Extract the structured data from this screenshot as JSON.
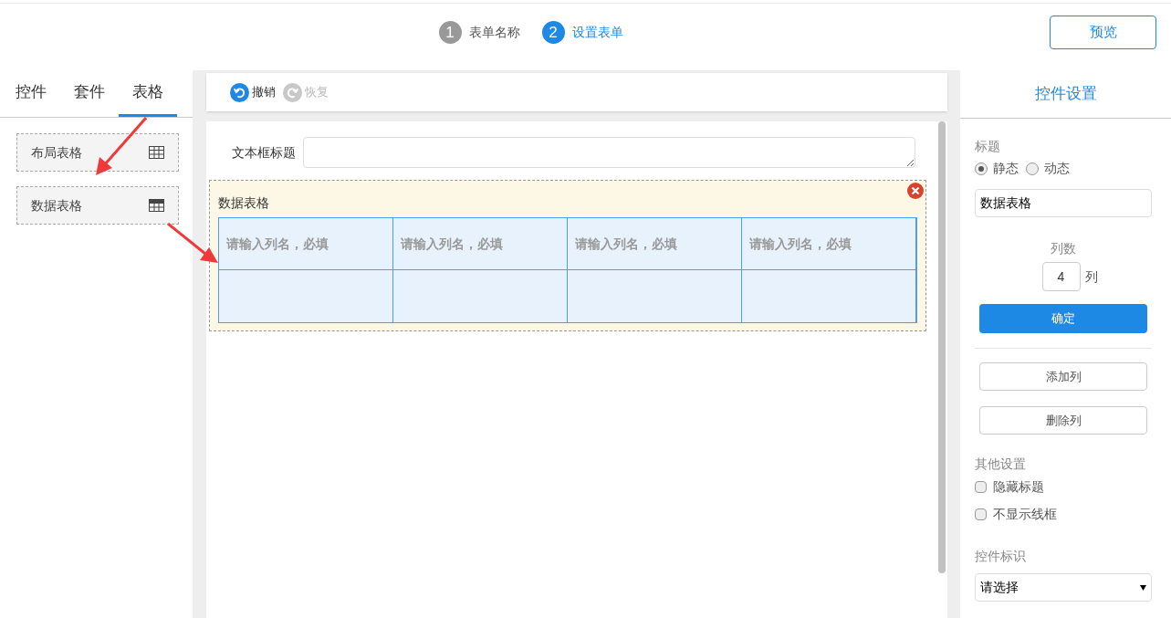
{
  "steps": [
    {
      "number": "1",
      "label": "表单名称",
      "selected": false
    },
    {
      "number": "2",
      "label": "设置表单",
      "selected": true
    }
  ],
  "preview_button": "预览",
  "left_tabs": [
    {
      "label": "控件",
      "selected": false
    },
    {
      "label": "套件",
      "selected": false
    },
    {
      "label": "表格",
      "selected": true
    }
  ],
  "left_items": [
    {
      "label": "布局表格",
      "kind": "layout"
    },
    {
      "label": "数据表格",
      "kind": "data"
    }
  ],
  "toolbar": [
    {
      "label": "撤销",
      "kind": "undo",
      "disabled": false
    },
    {
      "label": "恢复",
      "kind": "redo",
      "disabled": true
    }
  ],
  "text_field": {
    "label": "文本框标题"
  },
  "table_widget": {
    "title": "数据表格",
    "columns": [
      {
        "placeholder": "请输入列名，必填"
      },
      {
        "placeholder": "请输入列名，必填"
      },
      {
        "placeholder": "请输入列名，必填"
      },
      {
        "placeholder": "请输入列名，必填"
      }
    ]
  },
  "settings": {
    "title": "控件设置",
    "title_label": "标题",
    "radios": [
      {
        "label": "静态",
        "selected": true
      },
      {
        "label": "动态",
        "selected": false
      }
    ],
    "title_value": "数据表格",
    "column_count_label": "列数",
    "column_count": "4",
    "column_unit": "列",
    "confirm": "确定",
    "buttons": [
      "添加列",
      "删除列"
    ],
    "other_label": "其他设置",
    "checkboxes": [
      {
        "label": "隐藏标题",
        "checked": false
      },
      {
        "label": "不显示线框",
        "checked": false
      }
    ],
    "id_label": "控件标识",
    "id_select": "请选择"
  }
}
